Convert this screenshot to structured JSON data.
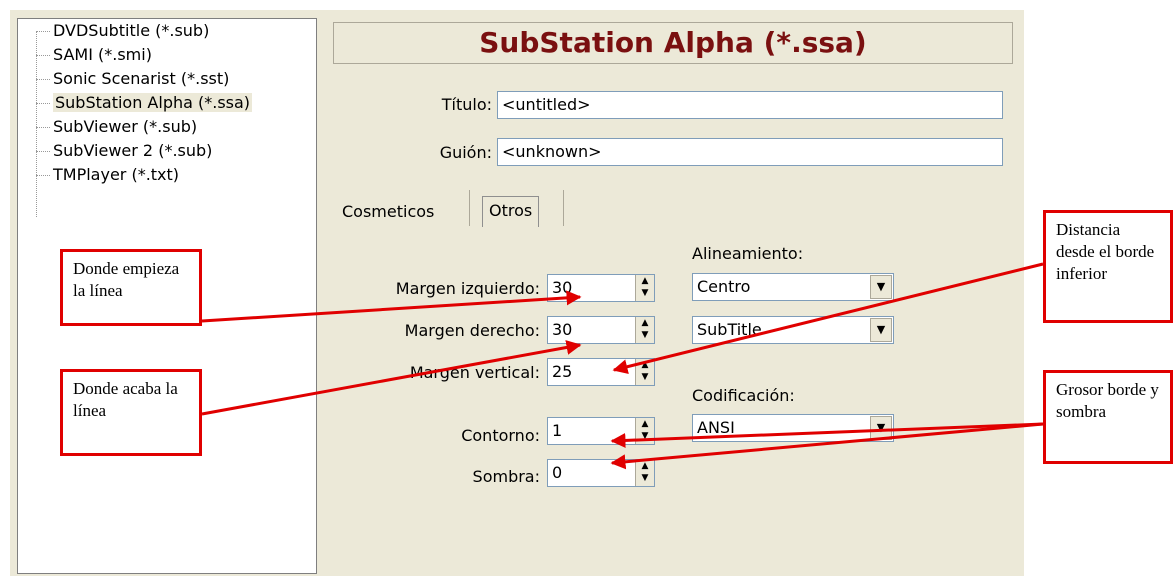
{
  "tree": {
    "items": [
      "DVDSubtitle (*.sub)",
      "SAMI (*.smi)",
      "Sonic Scenarist (*.sst)",
      "SubStation Alpha (*.ssa)",
      "SubViewer (*.sub)",
      "SubViewer 2 (*.sub)",
      "TMPlayer (*.txt)"
    ],
    "selected_index": 3
  },
  "header": {
    "title": "SubStation Alpha (*.ssa)"
  },
  "form": {
    "titulo_label": "Título:",
    "titulo_value": "<untitled>",
    "guion_label": "Guión:",
    "guion_value": "<unknown>"
  },
  "tabs": {
    "cosmeticos": "Cosmeticos",
    "otros": "Otros",
    "active": "Otros"
  },
  "margins": {
    "izquierdo_label": "Margen izquierdo:",
    "izquierdo_value": "30",
    "derecho_label": "Margen derecho:",
    "derecho_value": "30",
    "vertical_label": "Margen vertical:",
    "vertical_value": "25",
    "contorno_label": "Contorno:",
    "contorno_value": "1",
    "sombra_label": "Sombra:",
    "sombra_value": "0"
  },
  "alignment": {
    "label": "Alineamiento:",
    "value": "Centro",
    "style_value": "SubTitle"
  },
  "encoding": {
    "label": "Codificación:",
    "value": "ANSI"
  },
  "annotations": {
    "donde_empieza": "Donde empieza la línea",
    "donde_acaba": "Donde acaba la línea",
    "distancia": "Distancia desde el borde inferior",
    "grosor": "Grosor borde y sombra"
  },
  "colors": {
    "title": "#7a1010",
    "annotation": "#e00000",
    "panel": "#ece9d8"
  }
}
